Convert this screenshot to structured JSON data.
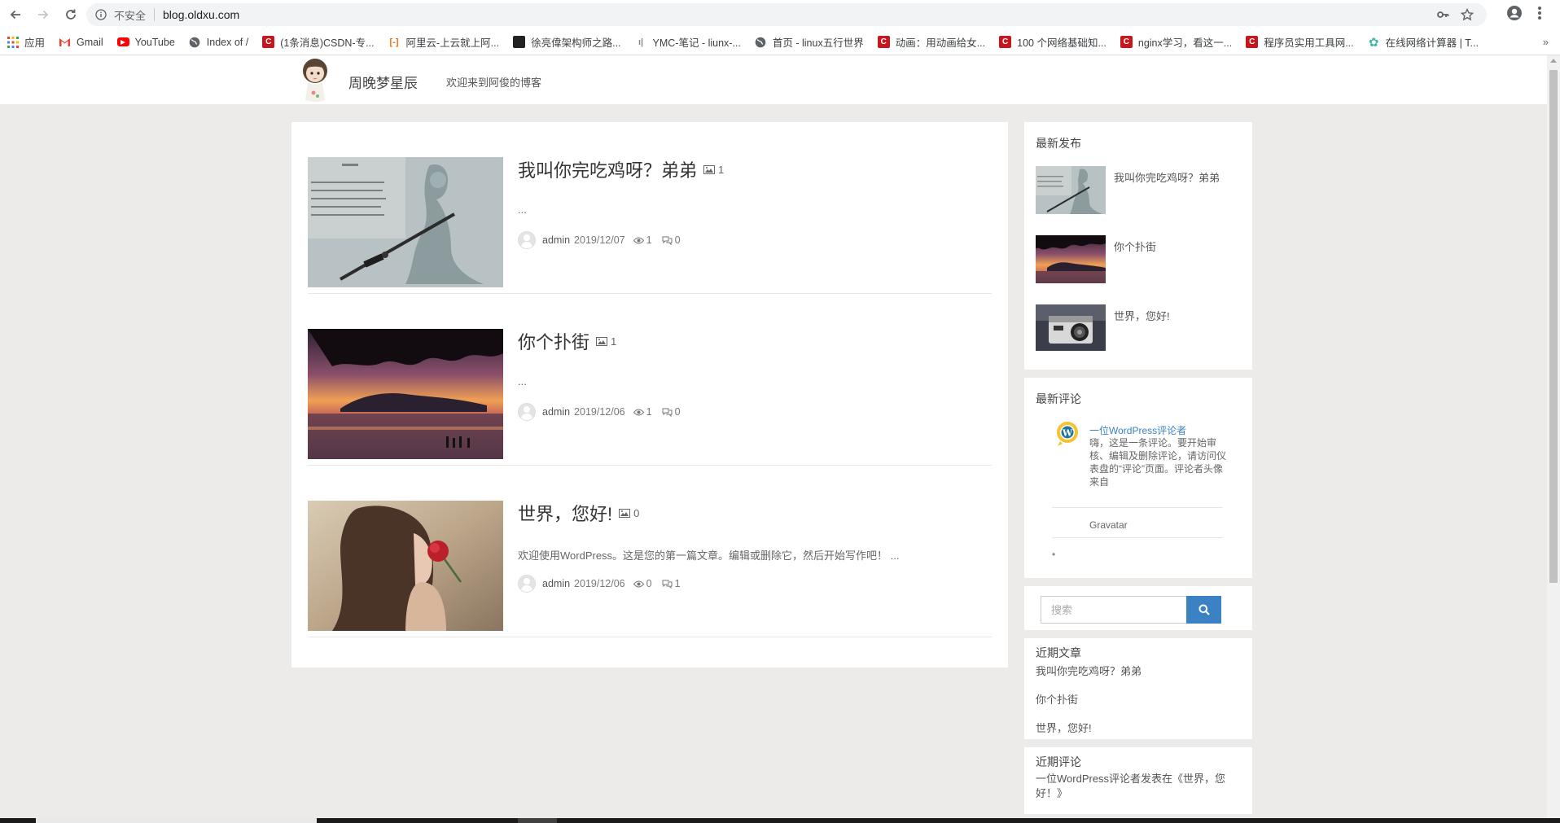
{
  "browser": {
    "insecure_label": "不安全",
    "url": "blog.oldxu.com",
    "bookmarks": [
      {
        "label": "应用",
        "color": "#4285f4"
      },
      {
        "label": "Gmail",
        "color": "#ea4335"
      },
      {
        "label": "YouTube",
        "color": "#ff0000"
      },
      {
        "label": "Index of /",
        "color": "#5f6368"
      },
      {
        "label": "(1条消息)CSDN-专...",
        "color": "#c8161d"
      },
      {
        "label": "阿里云-上云就上阿...",
        "color": "#ff6a00"
      },
      {
        "label": "徐亮偉架构师之路...",
        "color": "#222222"
      },
      {
        "label": "YMC-笔记 - liunx-...",
        "color": "#888888"
      },
      {
        "label": "首页 - linux五行世界",
        "color": "#5f6368"
      },
      {
        "label": "动画：用动画给女...",
        "color": "#c8161d"
      },
      {
        "label": "100 个网络基础知...",
        "color": "#c8161d"
      },
      {
        "label": "nginx学习，看这一...",
        "color": "#c8161d"
      },
      {
        "label": "程序员实用工具网...",
        "color": "#c8161d"
      },
      {
        "label": "在线网络计算器 | T...",
        "color": "#3fb8a0"
      }
    ],
    "more": "»"
  },
  "site": {
    "title": "周晚梦星辰",
    "tagline": "欢迎来到阿俊的博客"
  },
  "posts": [
    {
      "title": "我叫你完吃鸡呀？弟弟",
      "image_count": "1",
      "excerpt": "...",
      "author": "admin",
      "date": "2019/12/07",
      "views": "1",
      "comments": "0"
    },
    {
      "title": "你个扑街",
      "image_count": "1",
      "excerpt": "...",
      "author": "admin",
      "date": "2019/12/06",
      "views": "1",
      "comments": "0"
    },
    {
      "title": "世界，您好!",
      "image_count": "0",
      "excerpt": "欢迎使用WordPress。这是您的第一篇文章。编辑或删除它，然后开始写作吧！ ...",
      "author": "admin",
      "date": "2019/12/06",
      "views": "0",
      "comments": "1"
    }
  ],
  "sidebar": {
    "latest": {
      "title": "最新发布",
      "items": [
        "我叫你完吃鸡呀？弟弟",
        "你个扑街",
        "世界，您好!"
      ]
    },
    "comments": {
      "title": "最新评论",
      "author": "一位WordPress评论者",
      "text": "嗨，这是一条评论。要开始审核、编辑及删除评论，请访问仪表盘的“评论”页面。评论者头像来自",
      "gravatar": "Gravatar",
      "bullet": "•"
    },
    "search": {
      "placeholder": "搜索"
    },
    "recent_posts": {
      "title": "近期文章",
      "items": [
        "我叫你完吃鸡呀？弟弟",
        "你个扑街",
        "世界，您好!"
      ]
    },
    "recent_comments": {
      "title": "近期评论",
      "text": "一位WordPress评论者发表在《世界，您好！》"
    }
  }
}
